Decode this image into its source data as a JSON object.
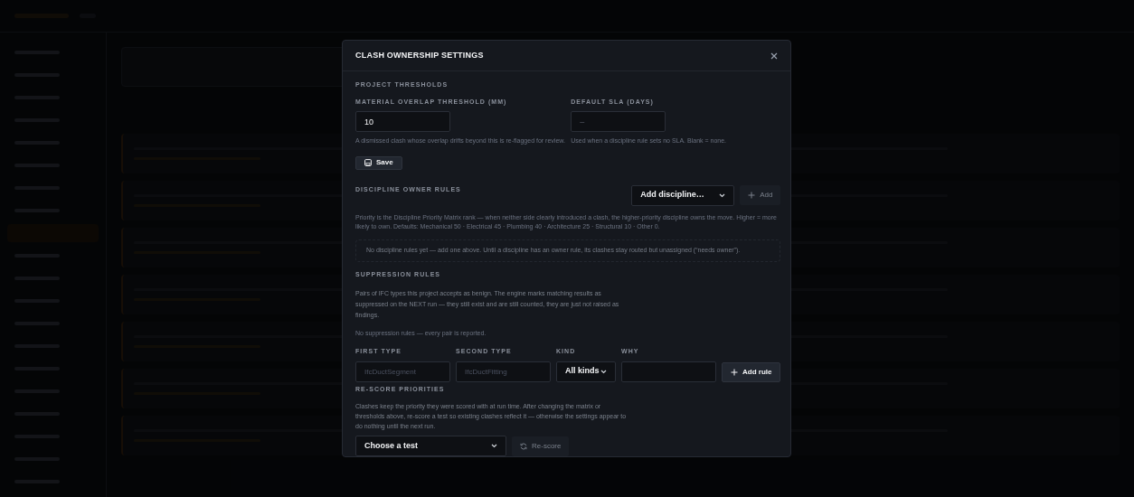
{
  "modal": {
    "title": "CLASH OWNERSHIP SETTINGS",
    "thresholds": {
      "heading": "PROJECT THRESHOLDS",
      "fields": [
        {
          "label": "MATERIAL OVERLAP THRESHOLD (MM)",
          "value": "10",
          "help": "A dismissed clash whose overlap drifts beyond this is re-flagged for review."
        },
        {
          "label": "DEFAULT SLA (DAYS)",
          "placeholder": "–",
          "help": "Used when a discipline rule sets no SLA. Blank = none."
        }
      ],
      "save_button": "Save"
    },
    "discipline": {
      "heading": "DISCIPLINE OWNER RULES",
      "select": "Add discipline…",
      "add_button": {
        "label": "Add",
        "disabled": true
      },
      "description": "Priority is the Discipline Priority Matrix rank — when neither side clearly introduced a clash, the higher-priority discipline owns the move. Higher = more likely to own. Defaults: Mechanical 50 · Electrical 45 · Plumbing 40 · Architecture 25 · Structural 10 · Other 0.",
      "empty_text": "No discipline rules yet — add one above. Until a discipline has an owner rule, its clashes stay routed but unassigned (“needs owner”)."
    },
    "suppression": {
      "heading": "SUPPRESSION RULES",
      "description": "Pairs of IFC types this project accepts as benign. The engine marks matching results as suppressed on the NEXT run — they still exist and are still counted, they are just not raised as findings.",
      "empty_text": "No suppression rules — every pair is reported.",
      "fields": [
        {
          "label": "FIRST TYPE",
          "kind": "input",
          "placeholder": "IfcDuctSegment"
        },
        {
          "label": "SECOND TYPE",
          "kind": "input",
          "placeholder": "IfcDuctFitting"
        },
        {
          "label": "KIND",
          "kind": "select",
          "value": "All kinds"
        },
        {
          "label": "WHY",
          "kind": "input"
        }
      ],
      "add_button": "Add rule"
    },
    "rescore": {
      "heading": "RE-SCORE PRIORITIES",
      "description": "Clashes keep the priority they were scored with at run time. After changing the matrix or thresholds above, re-score a test so existing clashes reflect it — otherwise the settings appear to do nothing until the next run.",
      "select": "Choose a test",
      "button": {
        "label": "Re-score",
        "disabled": true
      }
    }
  }
}
